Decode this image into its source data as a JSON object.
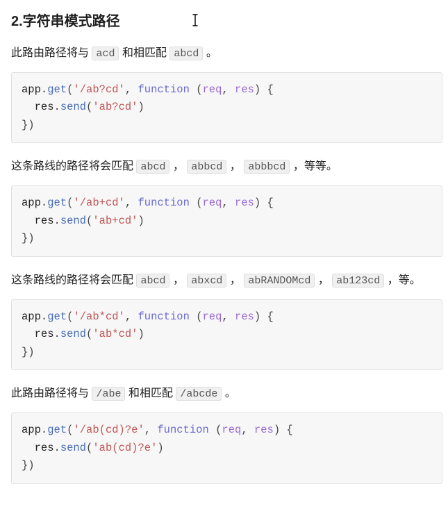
{
  "heading": "2.字符串模式路径",
  "sections": [
    {
      "prose": {
        "pre": "此路由路径将与",
        "c1": "acd",
        "mid": "和相匹配",
        "c2": "abcd",
        "post": "。"
      },
      "code": {
        "route": "'/ab?cd'",
        "send_arg": "'ab?cd'"
      }
    },
    {
      "prose": {
        "pre": "这条路线的路径将会匹配",
        "codes": [
          "abcd",
          "abbcd",
          "abbbcd"
        ],
        "tail": "，等等。"
      },
      "code": {
        "route": "'/ab+cd'",
        "send_arg": "'ab+cd'"
      }
    },
    {
      "prose": {
        "pre": "这条路线的路径将会匹配",
        "codes": [
          "abcd",
          "abxcd",
          "abRANDOMcd",
          "ab123cd"
        ],
        "tail": "，等。"
      },
      "code": {
        "route": "'/ab*cd'",
        "send_arg": "'ab*cd'"
      }
    },
    {
      "prose": {
        "pre": "此路由路径将与",
        "c1": "/abe",
        "mid": "和相匹配",
        "c2": "/abcde",
        "post": "。"
      },
      "code": {
        "route": "'/ab(cd)?e'",
        "send_arg": "'ab(cd)?e'"
      }
    }
  ],
  "code_common": {
    "obj": "app",
    "method": "get",
    "kw_function": "function",
    "param_req": "req",
    "param_res": "res",
    "send_obj": "res",
    "send_method": "send"
  }
}
